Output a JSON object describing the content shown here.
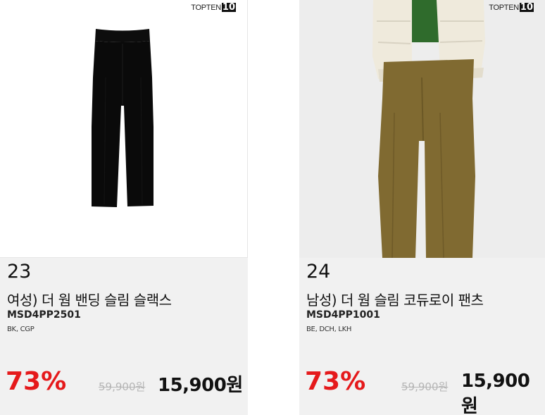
{
  "products": [
    {
      "brand": "TOPTEN",
      "brand_number": "10",
      "rank": "23",
      "name": "여성) 더 웜 밴딩 슬림 슬랙스",
      "code": "MSD4PP2501",
      "colors": "BK, CGP",
      "discount": "73%",
      "original_price": "59,900원",
      "price": "15,900원",
      "image_icon": "black-slacks-image"
    },
    {
      "brand": "TOPTEN",
      "brand_number": "10",
      "rank": "24",
      "name": "남성) 더 웜 슬림 코듀로이 팬츠",
      "code": "MSD4PP1001",
      "colors": "BE, DCH, LKH",
      "discount": "73%",
      "original_price": "59,900원",
      "price": "15,900원",
      "image_icon": "corduroy-pants-model-image"
    }
  ],
  "colors": {
    "discount": "#e5191b",
    "info_background": "#f1f1f1",
    "strike_price": "#b5b5b5"
  }
}
